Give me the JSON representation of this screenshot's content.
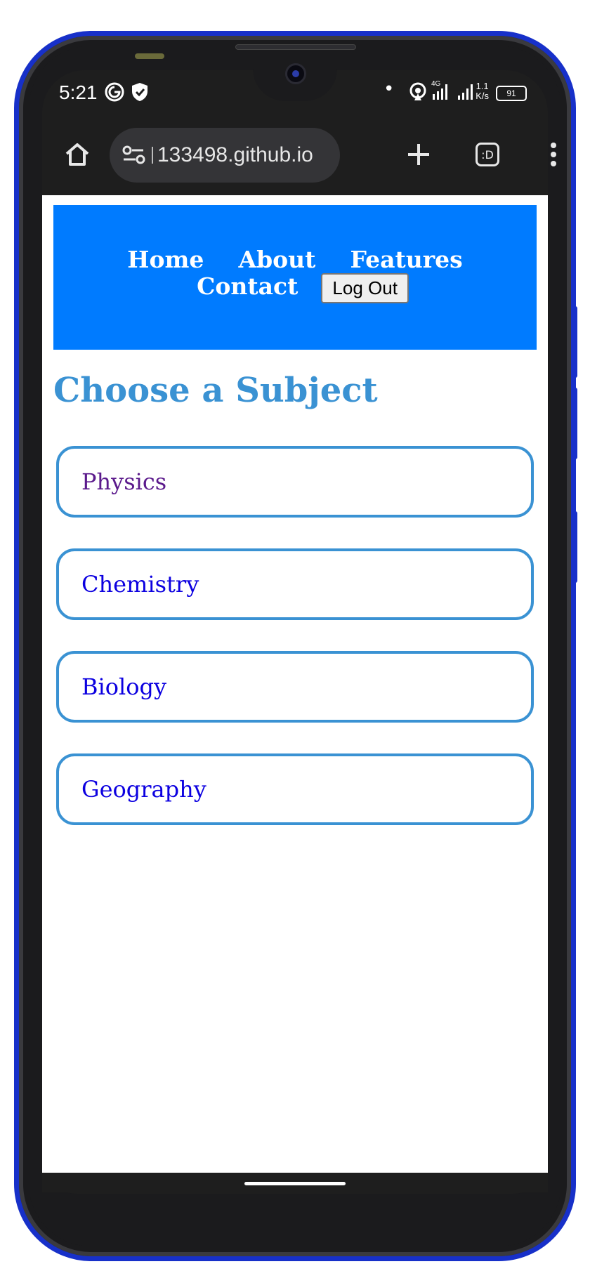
{
  "status_bar": {
    "time": "5:21",
    "net_speed_value": "1.1",
    "net_speed_unit": "K/s",
    "network_type": "4G",
    "battery_level": "91"
  },
  "browser": {
    "url": "133498.github.io"
  },
  "navbar": {
    "links": [
      "Home",
      "About",
      "Features",
      "Contact"
    ],
    "logout_label": "Log Out",
    "background": "#007bff"
  },
  "page": {
    "heading": "Choose a Subject",
    "subjects": [
      "Physics",
      "Chemistry",
      "Biology",
      "Geography"
    ]
  },
  "colors": {
    "accent": "#3a92d3",
    "link": "#0c00e0",
    "visited_link": "#5b1a8c",
    "phone_frame": "#1730c9"
  }
}
